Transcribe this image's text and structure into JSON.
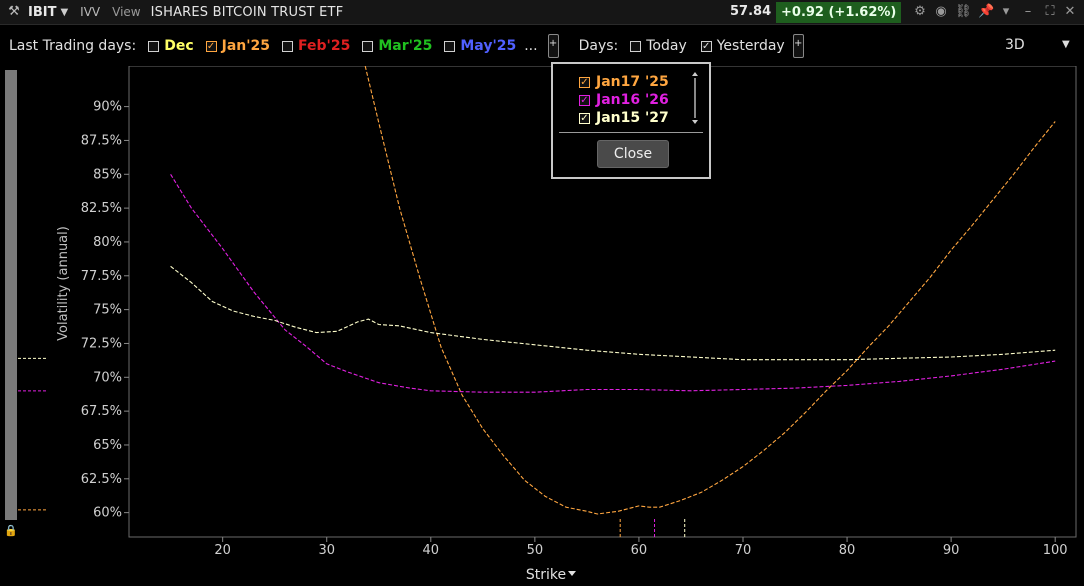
{
  "titlebar": {
    "symbol": "IBIT",
    "compare": "IVV",
    "view_menu": "View",
    "security_name": "ISHARES BITCOIN TRUST ETF",
    "last_price": "57.84",
    "change": "+0.92 (+1.62%)",
    "change_color": "#1e5e1e",
    "icons": [
      "gear-icon",
      "link-icon",
      "pin-icon",
      "minimize-icon",
      "maximize-icon",
      "close-icon"
    ]
  },
  "toolbar": {
    "trading_days_label": "Last Trading days:",
    "months": [
      {
        "label": "Dec",
        "checked": false,
        "color": "#ffff66"
      },
      {
        "label": "Jan'25",
        "checked": true,
        "color": "#ffa640"
      },
      {
        "label": "Feb'25",
        "checked": false,
        "color": "#e02020"
      },
      {
        "label": "Mar'25",
        "checked": false,
        "color": "#20c020"
      },
      {
        "label": "May'25",
        "checked": false,
        "color": "#5060ff"
      }
    ],
    "more": "...",
    "plus": "+",
    "days_label": "Days:",
    "today_label": "Today",
    "today_checked": false,
    "yesterday_label": "Yesterday",
    "yesterday_checked": true,
    "mode": "3D"
  },
  "popup": {
    "expirations": [
      {
        "label": "Jan17 '25",
        "checked": true,
        "color": "#ffa640"
      },
      {
        "label": "Jan16 '26",
        "checked": true,
        "color": "#e020e0"
      },
      {
        "label": "Jan15 '27",
        "checked": true,
        "color": "#ffffcc"
      }
    ],
    "close_label": "Close"
  },
  "chart_data": {
    "type": "line",
    "ylabel": "Volatility (annual)",
    "xlabel": "Strike",
    "xlim": [
      11,
      102
    ],
    "ylim": [
      58.2,
      93.0
    ],
    "x_ticks": [
      20,
      30,
      40,
      50,
      60,
      70,
      80,
      90,
      100
    ],
    "y_ticks": [
      {
        "v": 90,
        "label": "90%"
      },
      {
        "v": 87.5,
        "label": "87.5%"
      },
      {
        "v": 85,
        "label": "85%"
      },
      {
        "v": 82.5,
        "label": "82.5%"
      },
      {
        "v": 80,
        "label": "80%"
      },
      {
        "v": 77.5,
        "label": "77.5%"
      },
      {
        "v": 75,
        "label": "75%"
      },
      {
        "v": 72.5,
        "label": "72.5%"
      },
      {
        "v": 70,
        "label": "70%"
      },
      {
        "v": 67.5,
        "label": "67.5%"
      },
      {
        "v": 65,
        "label": "65%"
      },
      {
        "v": 62.5,
        "label": "62.5%"
      },
      {
        "v": 60,
        "label": "60%"
      }
    ],
    "grid": false,
    "series": [
      {
        "name": "Jan17 '25",
        "color": "#ffa640",
        "points": [
          [
            33.7,
            93
          ],
          [
            35,
            88.8
          ],
          [
            37,
            82.5
          ],
          [
            39,
            77.2
          ],
          [
            41,
            72.2
          ],
          [
            43,
            68.7
          ],
          [
            45,
            66.2
          ],
          [
            47,
            64.2
          ],
          [
            49,
            62.4
          ],
          [
            51,
            61.2
          ],
          [
            53,
            60.4
          ],
          [
            55,
            60.1
          ],
          [
            56,
            59.9
          ],
          [
            58,
            60.1
          ],
          [
            60,
            60.5
          ],
          [
            61,
            60.4
          ],
          [
            62,
            60.4
          ],
          [
            64,
            60.9
          ],
          [
            66,
            61.5
          ],
          [
            68,
            62.4
          ],
          [
            70,
            63.4
          ],
          [
            72,
            64.6
          ],
          [
            74,
            65.9
          ],
          [
            76,
            67.4
          ],
          [
            78,
            69.0
          ],
          [
            80,
            70.5
          ],
          [
            82,
            72.2
          ],
          [
            84,
            73.8
          ],
          [
            86,
            75.6
          ],
          [
            88,
            77.4
          ],
          [
            90,
            79.4
          ],
          [
            92,
            81.2
          ],
          [
            94,
            83.1
          ],
          [
            96,
            85.0
          ],
          [
            98,
            87.0
          ],
          [
            100,
            88.9
          ]
        ]
      },
      {
        "name": "Jan16 '26",
        "color": "#e020e0",
        "points": [
          [
            15,
            85
          ],
          [
            17,
            82.5
          ],
          [
            20,
            79.5
          ],
          [
            23,
            76.3
          ],
          [
            26,
            73.5
          ],
          [
            28,
            72.3
          ],
          [
            30,
            71.0
          ],
          [
            32,
            70.4
          ],
          [
            35,
            69.6
          ],
          [
            38,
            69.2
          ],
          [
            40,
            69.0
          ],
          [
            45,
            68.9
          ],
          [
            50,
            68.9
          ],
          [
            55,
            69.1
          ],
          [
            60,
            69.1
          ],
          [
            65,
            69.0
          ],
          [
            70,
            69.1
          ],
          [
            75,
            69.2
          ],
          [
            80,
            69.4
          ],
          [
            85,
            69.7
          ],
          [
            90,
            70.1
          ],
          [
            95,
            70.6
          ],
          [
            100,
            71.2
          ]
        ]
      },
      {
        "name": "Jan15 '27",
        "color": "#ffffcc",
        "points": [
          [
            15,
            78.2
          ],
          [
            17,
            77.0
          ],
          [
            19,
            75.6
          ],
          [
            21,
            74.9
          ],
          [
            23,
            74.5
          ],
          [
            25,
            74.2
          ],
          [
            27,
            73.7
          ],
          [
            29,
            73.3
          ],
          [
            31,
            73.4
          ],
          [
            33,
            74.1
          ],
          [
            34,
            74.3
          ],
          [
            35,
            73.9
          ],
          [
            37,
            73.8
          ],
          [
            40,
            73.3
          ],
          [
            45,
            72.8
          ],
          [
            50,
            72.4
          ],
          [
            55,
            72.0
          ],
          [
            60,
            71.7
          ],
          [
            65,
            71.5
          ],
          [
            70,
            71.3
          ],
          [
            75,
            71.3
          ],
          [
            80,
            71.3
          ],
          [
            85,
            71.4
          ],
          [
            90,
            71.5
          ],
          [
            95,
            71.7
          ],
          [
            100,
            72.0
          ]
        ]
      }
    ],
    "left_markers": [
      {
        "v": 71.4,
        "color": "#ffffcc"
      },
      {
        "v": 69.0,
        "color": "#e020e0"
      },
      {
        "v": 60.2,
        "color": "#ffa640"
      }
    ],
    "bottom_markers": [
      {
        "x": 58.2,
        "color": "#ffa640"
      },
      {
        "x": 61.5,
        "color": "#e020e0"
      },
      {
        "x": 64.4,
        "color": "#ffffcc"
      }
    ]
  }
}
